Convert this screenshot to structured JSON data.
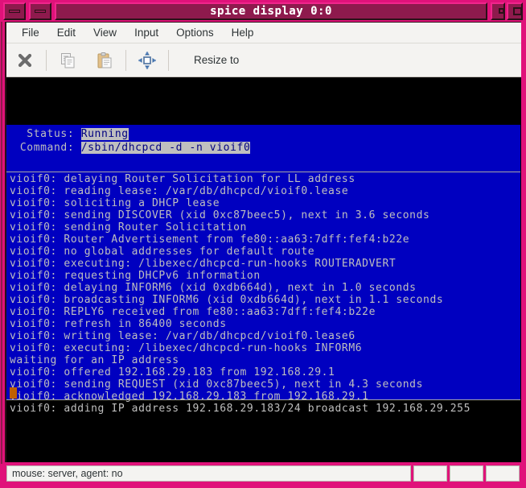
{
  "window": {
    "title": "spice display 0:0",
    "titlebar_buttons": [
      {
        "name": "minimize-left-1",
        "glyph": "bar"
      },
      {
        "name": "minimize-left-2",
        "glyph": "bar"
      },
      {
        "name": "maximize",
        "glyph": "square-small"
      },
      {
        "name": "close",
        "glyph": "square"
      }
    ],
    "colors": {
      "titlebar": "#e0127a",
      "titlebar_fill": "#8e1a4d",
      "terminal_bg": "#000000",
      "terminal_panel": "#0000c0",
      "terminal_fg": "#bfbfbf",
      "cursor": "#c06000"
    }
  },
  "menubar": {
    "items": [
      {
        "label": "File"
      },
      {
        "label": "Edit"
      },
      {
        "label": "View"
      },
      {
        "label": "Input"
      },
      {
        "label": "Options"
      },
      {
        "label": "Help"
      }
    ]
  },
  "toolbar": {
    "items": [
      {
        "name": "disconnect-icon",
        "label": ""
      },
      {
        "name": "copy-icon",
        "label": ""
      },
      {
        "name": "paste-icon",
        "label": ""
      },
      {
        "name": "fullscreen-resize-icon",
        "label": ""
      }
    ],
    "resize_label": "Resize to"
  },
  "terminal": {
    "status_panel": {
      "status_label": "   Status: ",
      "status_value": "Running",
      "command_label": "  Command: ",
      "command_value": "/sbin/dhcpcd -d -n vioif0"
    },
    "log_lines": [
      "vioif0: delaying Router Solicitation for LL address",
      "vioif0: reading lease: /var/db/dhcpcd/vioif0.lease",
      "vioif0: soliciting a DHCP lease",
      "vioif0: sending DISCOVER (xid 0xc87beec5), next in 3.6 seconds",
      "vioif0: sending Router Solicitation",
      "vioif0: Router Advertisement from fe80::aa63:7dff:fef4:b22e",
      "vioif0: no global addresses for default route",
      "vioif0: executing: /libexec/dhcpcd-run-hooks ROUTERADVERT",
      "vioif0: requesting DHCPv6 information",
      "vioif0: delaying INFORM6 (xid 0xdb664d), next in 1.0 seconds",
      "vioif0: broadcasting INFORM6 (xid 0xdb664d), next in 1.1 seconds",
      "vioif0: REPLY6 received from fe80::aa63:7dff:fef4:b22e",
      "vioif0: refresh in 86400 seconds",
      "vioif0: writing lease: /var/db/dhcpcd/vioif0.lease6",
      "vioif0: executing: /libexec/dhcpcd-run-hooks INFORM6",
      "waiting for an IP address",
      "vioif0: offered 192.168.29.183 from 192.168.29.1",
      "vioif0: sending REQUEST (xid 0xc87beec5), next in 4.3 seconds",
      "vioif0: acknowledged 192.168.29.183 from 192.168.29.1",
      "vioif0: adding IP address 192.168.29.183/24 broadcast 192.168.29.255"
    ]
  },
  "statusbar": {
    "message": "mouse: server, agent:  no",
    "extra_cells": [
      "",
      "",
      ""
    ]
  }
}
